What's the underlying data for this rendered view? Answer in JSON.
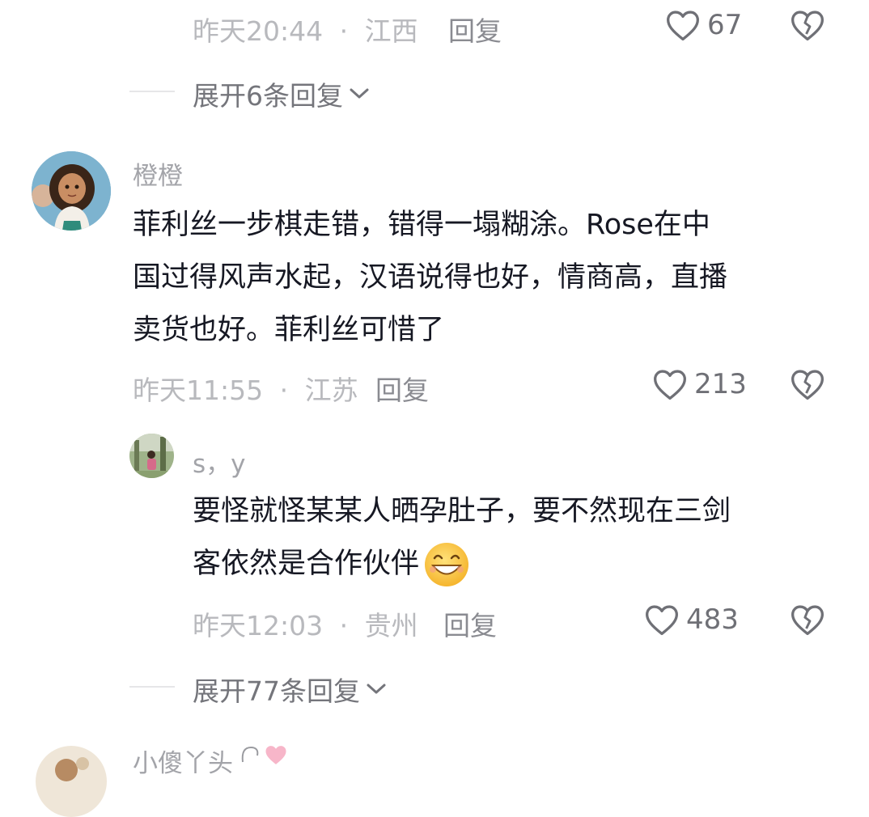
{
  "thread_top": {
    "time": "昨天20:44",
    "sep": "·",
    "location": "江西",
    "reply_label": "回复",
    "likes": "67",
    "expand_label": "展开6条回复"
  },
  "comment_main": {
    "username": "橙橙",
    "lines": [
      "菲利丝一步棋走错，错得一塌糊涂。Rose在中",
      "国过得风声水起，汉语说得也好，情商高，直播",
      "卖货也好。菲利丝可惜了"
    ],
    "time": "昨天11:55",
    "sep": "·",
    "location": "江苏",
    "reply_label": "回复",
    "likes": "213"
  },
  "reply_sy": {
    "username": "s，y",
    "lines": [
      "要怪就怪某某人晒孕肚子，要不然现在三剑",
      "客依然是合作伙伴"
    ],
    "emoji": "grin-emoji",
    "time": "昨天12:03",
    "sep": "·",
    "location": "贵州",
    "reply_label": "回复",
    "likes": "483",
    "expand_label": "展开77条回复"
  },
  "next_comment": {
    "username_partial": "小傻丫头"
  },
  "colors": {
    "meta": "#b8b9bd",
    "text": "#161823",
    "icon": "#6f7076"
  }
}
